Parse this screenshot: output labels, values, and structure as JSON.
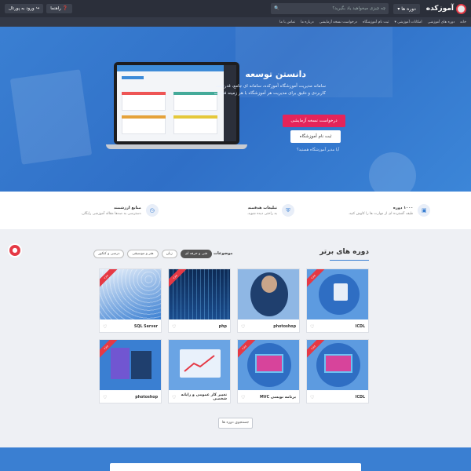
{
  "topbar": {
    "logo_text": "آموزکده",
    "courses_label": "دوره ها ▾",
    "search_placeholder": "چه چیزی میخواهید یاد بگیرید؟",
    "help_label": "راهنما",
    "portal_label": "ورود به پورتال"
  },
  "nav": {
    "items": [
      "خانه",
      "دوره های آموزشی",
      "امکانات آموزشی ▾",
      "ثبت نام آموزشگاه",
      "درخواست نسخه آزمایشی",
      "درباره ما",
      "تماس با ما"
    ]
  },
  "hero": {
    "title": "دانستن توسعه",
    "text": "سامانه مدیریت آموزشگاه آموزکده، سامانه ای جامع، قدرتمند، کاربردی و دقیق برای مدیریت هر آموزشگاه با هر زمینه فعالیت",
    "btn_trial": "درخواست نسخه آزمایشی",
    "btn_register": "ثبت نام آموزشگاه",
    "link": "آیا مدیر آموزشگاه هستید؟"
  },
  "features": [
    {
      "title": "۱۰۰۰ دوره",
      "subtitle": "طیف گسترده ای از مهارت ها را کاوش کنید.",
      "icon": "play-icon"
    },
    {
      "title": "تبلیغات هدفمند",
      "subtitle": "به راحتی دیده شوید.",
      "icon": "shield-icon"
    },
    {
      "title": "منابع ارزشمند",
      "subtitle": "دسترسی به صدها مقاله آموزشی رایگان.",
      "icon": "clock-icon"
    }
  ],
  "section": {
    "title": "دوره های برتر",
    "topics_label": "موضوعات",
    "chips": [
      "فنی و حرفه ای",
      "زبان",
      "هنر و موسیقی",
      "درسی و کنکور"
    ],
    "more_button": "جستجوی دوره ها"
  },
  "courses": [
    {
      "title": "ICDL",
      "ribbon": "ویژه",
      "theme": "office"
    },
    {
      "title": "photoshop",
      "ribbon": "",
      "theme": "person"
    },
    {
      "title": "php",
      "ribbon": "ویژه",
      "theme": "code"
    },
    {
      "title": "SQL Server",
      "ribbon": "ویژه",
      "theme": "sql"
    },
    {
      "title": "ICDL",
      "ribbon": "ویژه",
      "theme": "monitor"
    },
    {
      "title": "برنامه نویسی MVC",
      "ribbon": "ویژه",
      "theme": "monitor"
    },
    {
      "title": "تغییر کار عمومی و رایانه شخصی",
      "ribbon": "",
      "theme": "chart"
    },
    {
      "title": "photoshop",
      "ribbon": "ویژه",
      "theme": "ps"
    }
  ],
  "colors": {
    "accent": "#3a7fd2",
    "brand_red": "#e53945",
    "dark": "#2b2f3a"
  }
}
